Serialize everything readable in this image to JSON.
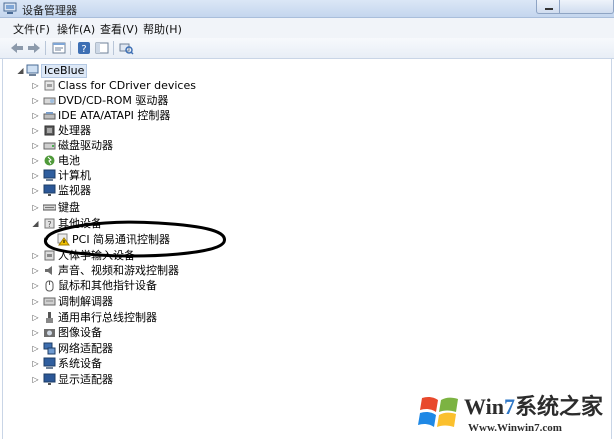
{
  "window": {
    "title": "设备管理器"
  },
  "menu": [
    {
      "label": "文件(F)"
    },
    {
      "label": "操作(A)"
    },
    {
      "label": "查看(V)"
    },
    {
      "label": "帮助(H)"
    }
  ],
  "toolbar": {
    "buttons": [
      "back-icon",
      "forward-icon",
      "properties-icon",
      "help-icon",
      "view-icon",
      "scan-hardware-icon"
    ]
  },
  "tree": {
    "root": {
      "label": "IceBlue",
      "expanded": true
    },
    "categories": [
      {
        "label": "Class for CDriver devices",
        "icon": "usb-device-icon",
        "expanded": false
      },
      {
        "label": "DVD/CD-ROM 驱动器",
        "icon": "optical-drive-icon",
        "expanded": false
      },
      {
        "label": "IDE ATA/ATAPI 控制器",
        "icon": "ide-controller-icon",
        "expanded": false
      },
      {
        "label": "处理器",
        "icon": "processor-icon",
        "expanded": false
      },
      {
        "label": "磁盘驱动器",
        "icon": "disk-drive-icon",
        "expanded": false
      },
      {
        "label": "电池",
        "icon": "battery-icon",
        "expanded": false
      },
      {
        "label": "计算机",
        "icon": "computer-icon",
        "expanded": false
      },
      {
        "label": "监视器",
        "icon": "monitor-icon",
        "expanded": false
      },
      {
        "label": "键盘",
        "icon": "keyboard-icon",
        "expanded": false
      },
      {
        "label": "其他设备",
        "icon": "other-devices-icon",
        "expanded": true,
        "children": [
          {
            "label": "PCI 简易通讯控制器",
            "icon": "unknown-device-warning-icon"
          }
        ]
      },
      {
        "label": "人体学输入设备",
        "icon": "hid-icon",
        "expanded": false
      },
      {
        "label": "声音、视频和游戏控制器",
        "icon": "sound-icon",
        "expanded": false
      },
      {
        "label": "鼠标和其他指针设备",
        "icon": "mouse-icon",
        "expanded": false
      },
      {
        "label": "调制解调器",
        "icon": "modem-icon",
        "expanded": false
      },
      {
        "label": "通用串行总线控制器",
        "icon": "usb-controller-icon",
        "expanded": false
      },
      {
        "label": "图像设备",
        "icon": "imaging-device-icon",
        "expanded": false
      },
      {
        "label": "网络适配器",
        "icon": "network-adapter-icon",
        "expanded": false
      },
      {
        "label": "系统设备",
        "icon": "system-device-icon",
        "expanded": false
      },
      {
        "label": "显示适配器",
        "icon": "display-adapter-icon",
        "expanded": false
      }
    ]
  },
  "watermark": {
    "brand_prefix": "Win",
    "brand_seven": "7",
    "brand_suffix": "系统之家",
    "url": "Www.Winwin7.com"
  },
  "colors": {
    "title_bar": "#c4d6ee",
    "root_highlight": "#dde8f6",
    "brand_blue": "#2f77c6",
    "annotation_ellipse": "#000000"
  }
}
